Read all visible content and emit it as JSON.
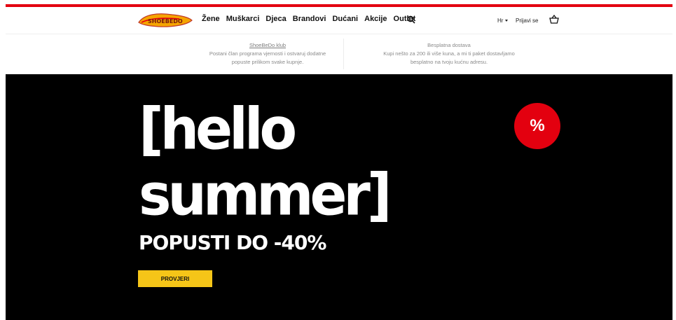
{
  "colors": {
    "brand_red": "#e3000f",
    "cta_yellow": "#f5c518",
    "hero_bg": "#000000"
  },
  "header": {
    "logo_text": "SHOEBEDO",
    "nav": [
      "Žene",
      "Muškarci",
      "Djeca",
      "Brandovi",
      "Dućani",
      "Akcije",
      "Outlet"
    ],
    "search_icon": "search-icon",
    "language": "Hr",
    "login": "Prijavi se",
    "basket_icon": "basket-icon"
  },
  "info_bar": {
    "club": {
      "title": "ShoeBeDo klub",
      "line1": "Postani član programa vjernosti i ostvaruj dodatne",
      "line2": "popuste prilikom svake kupnje."
    },
    "delivery": {
      "title": "Besplatna dostava",
      "line1": "Kupi nešto za 200 ili više kuna, a mi ti paket dostavljamo",
      "line2": "besplatno na tvoju kućnu adresu."
    }
  },
  "hero": {
    "line1": "[hello",
    "line2": "summer]",
    "subtitle": "POPUSTI DO -40%",
    "cta": "PROVJERI",
    "badge": "%"
  }
}
